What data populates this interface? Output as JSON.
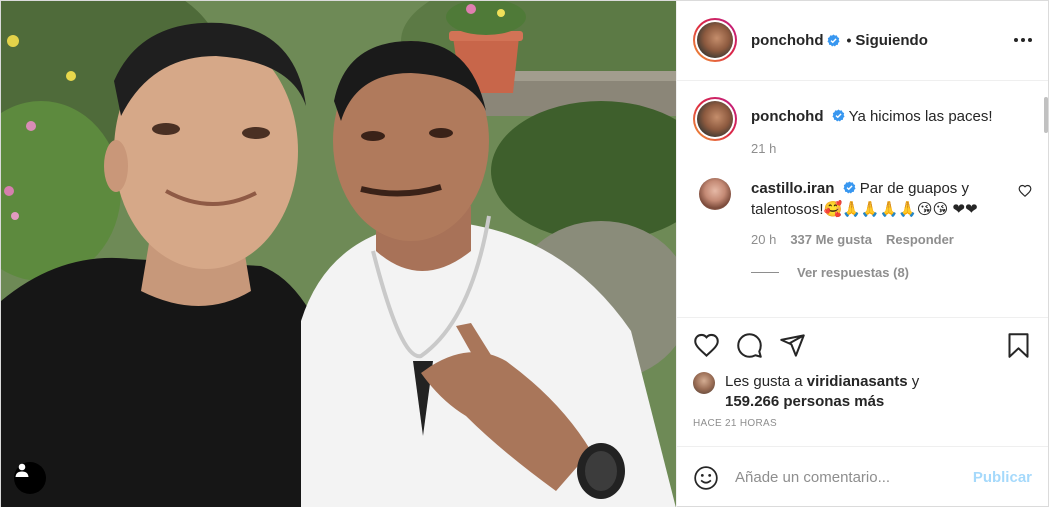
{
  "post": {
    "author": "ponchohd",
    "follow_status": "Siguiendo",
    "separator": "•",
    "caption": "Ya hicimos las paces!",
    "caption_age": "21 h"
  },
  "comment": {
    "author": "castillo.iran",
    "text": "Par de guapos y talentosos!🥰🙏🙏🙏🙏😘😘 ❤❤",
    "age": "20 h",
    "likes": "337 Me gusta",
    "reply_label": "Responder",
    "view_replies": "Ver respuestas (8)"
  },
  "likes": {
    "prefix": "Les gusta a",
    "user": "viridianasants",
    "joiner": "y",
    "count": "159.266 personas más"
  },
  "timestamp": "HACE 21 HORAS",
  "comment_box": {
    "placeholder": "Añade un comentario...",
    "publish_label": "Publicar"
  },
  "colors": {
    "accent": "#0095f6",
    "verified": "#3897f0",
    "text": "#262626",
    "muted": "#8e8e8e"
  },
  "icons": [
    "verified-icon",
    "more-options-icon",
    "heart-icon",
    "comment-icon",
    "share-icon",
    "bookmark-icon",
    "emoji-icon",
    "user-tag-icon"
  ]
}
